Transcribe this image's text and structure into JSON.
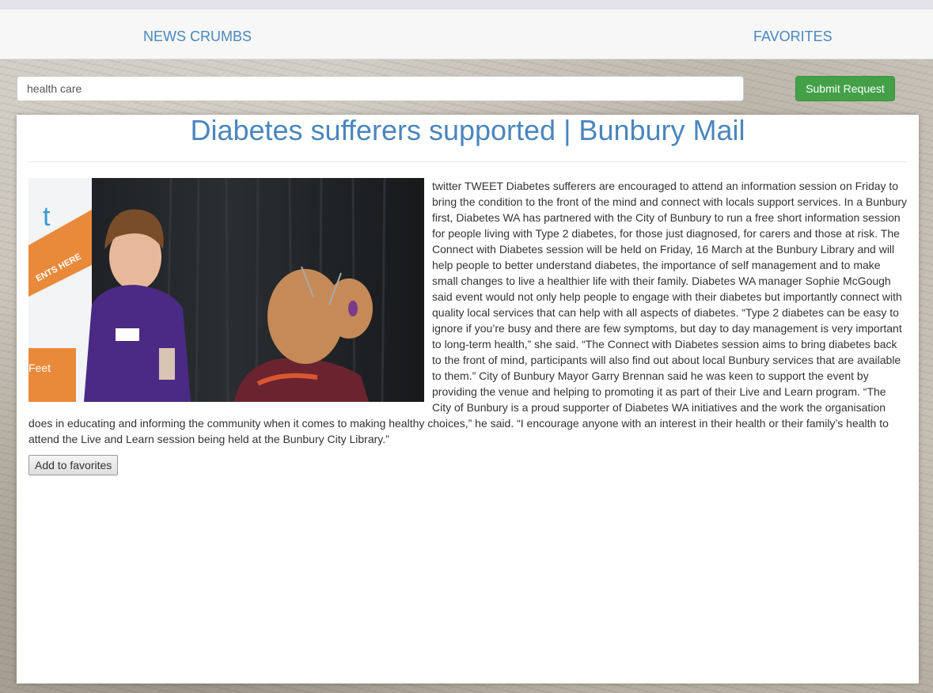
{
  "nav": {
    "brand": "NEWS CRUMBS",
    "favorites": "FAVORITES"
  },
  "search": {
    "value": "health care",
    "submit_label": "Submit Request"
  },
  "article": {
    "title": "Diabetes sufferers supported | Bunbury Mail",
    "image_alt": "Diabetes WA staff member talking with a woman at an information stand",
    "body": "twitter TWEET Diabetes sufferers are encouraged to attend an information session on Friday to bring the condition to the front of the mind and connect with locals support services. In a Bunbury first, Diabetes WA has partnered with the City of Bunbury to run a free short information session for people living with Type 2 diabetes, for those just diagnosed, for carers and those at risk. The Connect with Diabetes session will be held on Friday, 16 March at the Bunbury Library and will help people to better understand diabetes, the importance of self management and to make small changes to live a healthier life with their family. Diabetes WA manager Sophie McGough said event would not only help people to engage with their diabetes but importantly connect with quality local services that can help with all aspects of diabetes. “Type 2 diabetes can be easy to ignore if you’re busy and there are few symptoms, but day to day management is very important to long-term health,” she said. “The Connect with Diabetes session aims to bring diabetes back to the front of mind, participants will also find out about local Bunbury services that are available to them.” City of Bunbury Mayor Garry Brennan said he was keen to support the event by providing the venue and helping to promoting it as part of their Live and Learn program. “The City of Bunbury is a proud supporter of Diabetes WA initiatives and the work the organisation does in educating and informing the community when it comes to making healthy choices,” he said. “I encourage anyone with an interest in their health or their family’s health to attend the Live and Learn session being held at the Bunbury City Library.”",
    "add_favorites_label": "Add to favorites"
  },
  "colors": {
    "link": "#4a86bd",
    "submit": "#43a047"
  }
}
